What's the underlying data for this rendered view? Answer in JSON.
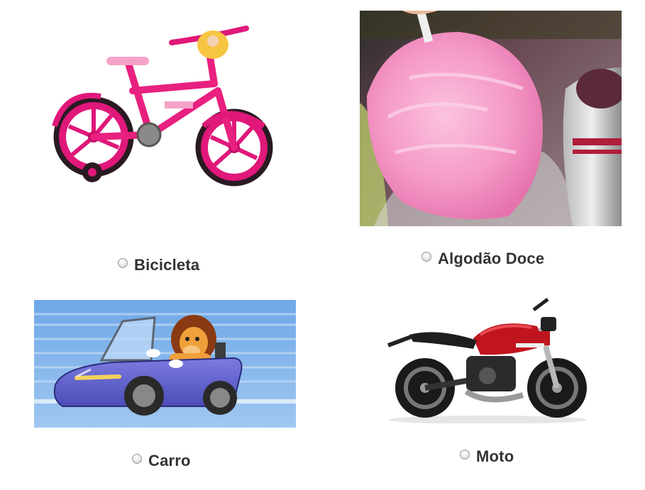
{
  "options": [
    {
      "label": "Bicicleta",
      "image": "pink-bicycle-image",
      "selected": false
    },
    {
      "label": "Algodão Doce",
      "image": "cotton-candy-image",
      "selected": false
    },
    {
      "label": "Carro",
      "image": "cartoon-car-image",
      "selected": false
    },
    {
      "label": "Moto",
      "image": "motorcycle-image",
      "selected": false
    }
  ],
  "colors": {
    "text": "#333333",
    "bike_pink": "#e0187a",
    "candy_pink": "#f59ac8",
    "car_blue": "#6262cf",
    "moto_red": "#c0151e"
  },
  "icons": [
    "radio-icon"
  ]
}
